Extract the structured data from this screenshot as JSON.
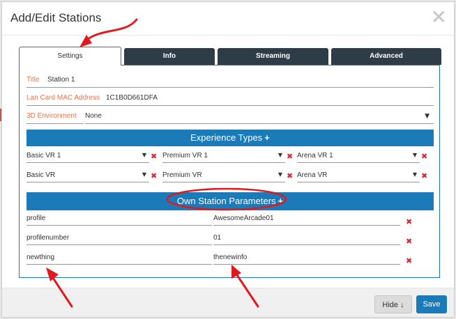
{
  "dialog": {
    "title": "Add/Edit Stations",
    "close_glyph": "✕"
  },
  "tabs": [
    {
      "label": "Settings",
      "active": true
    },
    {
      "label": "Info",
      "active": false
    },
    {
      "label": "Streaming",
      "active": false
    },
    {
      "label": "Advanced",
      "active": false
    }
  ],
  "settings": {
    "title_label": "Title",
    "title_value": "Station 1",
    "mac_label": "Lan Card MAC Address",
    "mac_value": "1C1B0D661DFA",
    "env_label": "3D Environment",
    "env_value": "None"
  },
  "experience_types": {
    "heading": "Experience Types",
    "plus": "+",
    "rows": [
      [
        "Basic VR 1",
        "Premium VR 1",
        "Arena VR 1"
      ],
      [
        "Basic VR",
        "Premium VR",
        "Arena VR"
      ]
    ]
  },
  "own_params": {
    "heading": "Own Station Parameters",
    "plus": "+",
    "rows": [
      {
        "key": "profile",
        "value": "AwesomeArcade01"
      },
      {
        "key": "profilenumber",
        "value": "01"
      },
      {
        "key": "newthing",
        "value": "thenewinfo"
      }
    ]
  },
  "icons": {
    "caret": "▼",
    "remove": "✖"
  },
  "footer": {
    "hide_label": "Hide ↓",
    "save_label": "Save"
  },
  "colors": {
    "accent": "#1a7bb8",
    "tab_dark": "#2d3c47",
    "label_orange": "#e8744a",
    "underline_teal": "#5ab3a7",
    "remove_red": "#d9272e",
    "annotation_red": "#e0191f"
  }
}
